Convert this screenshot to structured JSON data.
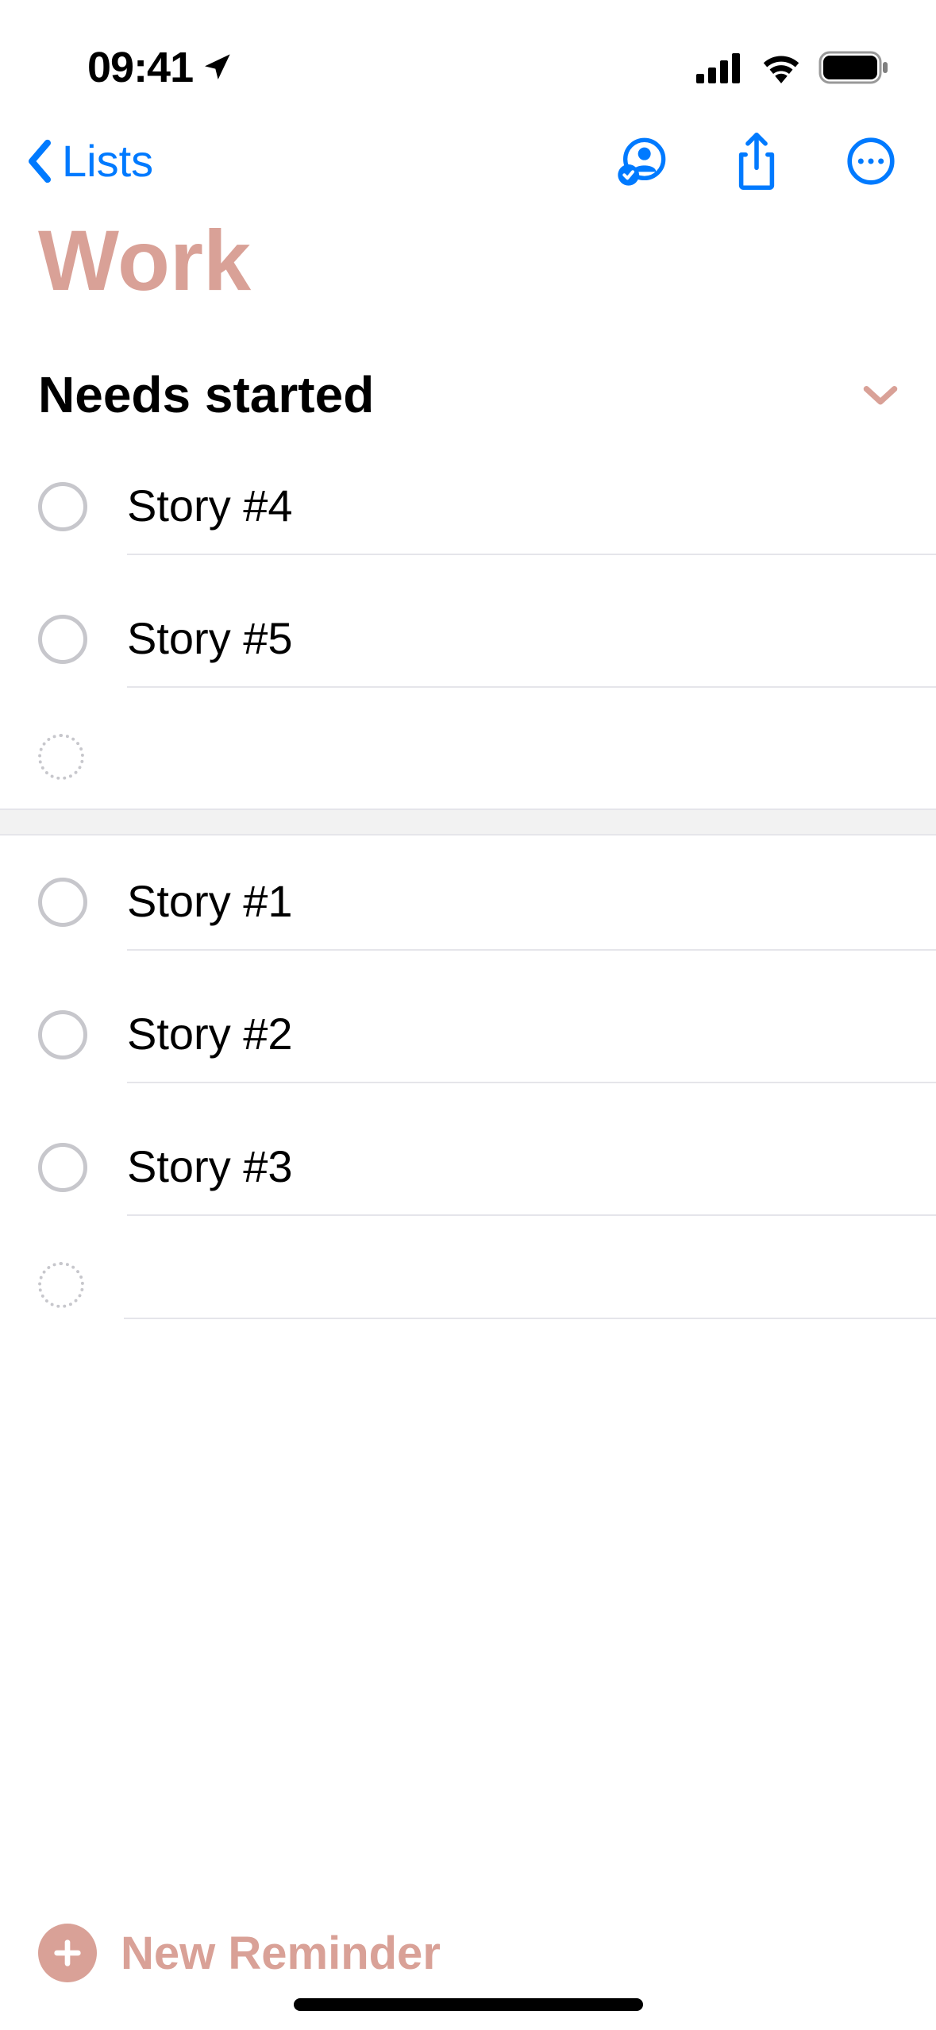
{
  "status": {
    "time": "09:41"
  },
  "nav": {
    "back_label": "Lists"
  },
  "title": "Work",
  "sections": [
    {
      "title": "Needs started",
      "items": [
        {
          "title": "Story #4"
        },
        {
          "title": "Story #5"
        }
      ]
    },
    {
      "title": "",
      "items": [
        {
          "title": "Story #1"
        },
        {
          "title": "Story #2"
        },
        {
          "title": "Story #3"
        }
      ]
    }
  ],
  "footer": {
    "new_reminder_label": "New Reminder"
  },
  "colors": {
    "accent": "#d9a197",
    "ios_blue": "#007aff"
  }
}
